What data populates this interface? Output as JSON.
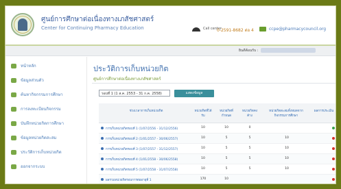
{
  "header": {
    "org_name_th": "ศูนย์การศึกษาต่อเนื่องทางเภสัชศาสตร์",
    "org_name_en": "Center for Continuing Pharmacy Education",
    "tel_label": "Call center",
    "tel_number": "0-2591-8682 ต่อ 4",
    "email": "ccpe@pharmacycouncil.org"
  },
  "userbar": {
    "label": "ยินดีต้อนรับ :"
  },
  "sidebar": {
    "items": [
      {
        "label": "หน้าหลัก"
      },
      {
        "label": "ข้อมูลส่วนตัว"
      },
      {
        "label": "ค้นหากิจกรรมการศึกษา"
      },
      {
        "label": "การลงทะเบียนกิจกรรม"
      },
      {
        "label": "บันทึกหน่วยกิตการศึกษา"
      },
      {
        "label": "ข้อมูลหน่วยกิตสะสม"
      },
      {
        "label": "ประวัติการเก็บหน่วยกิต"
      },
      {
        "label": "ออกจากระบบ"
      }
    ]
  },
  "main": {
    "title": "ประวัติการเก็บหน่วยกิต",
    "subtitle": "ศูนย์การศึกษาต่อเนื่องทางเภสัชศาสตร์",
    "select_value": "รอบที่ 1 (1 ส.ค. 2553 - 31 ก.ค. 2558)",
    "button_label": "แสดงข้อมูล"
  },
  "table": {
    "headers": [
      "ช่วงเวลาการเก็บหน่วยกิต",
      "หน่วยกิตที่ได้รับ",
      "หน่วยกิตที่กำหนด",
      "หน่วยกิตคงค้าง",
      "หน่วยกิตสะสมทั้งหมดจาก กิจกรรมการศึกษา",
      "ผลการประเมิน"
    ],
    "rows": [
      {
        "name": "การเก็บหน่วยกิตรอบที่ 1 (1/07/2556 - 31/12/2556)",
        "c1": "10",
        "c2": "10",
        "c3": "0",
        "c4": "",
        "status": "#3aa34a"
      },
      {
        "name": "การเก็บหน่วยกิตรอบที่ 2 (1/01/2557 - 30/06/2557)",
        "c1": "10",
        "c2": "5",
        "c3": "5",
        "c4": "10",
        "status": "#d8322b"
      },
      {
        "name": "การเก็บหน่วยกิตรอบที่ 3 (1/07/2557 - 31/12/2557)",
        "c1": "10",
        "c2": "5",
        "c3": "5",
        "c4": "10",
        "status": "#d8322b"
      },
      {
        "name": "การเก็บหน่วยกิตรอบที่ 4 (1/01/2558 - 30/06/2558)",
        "c1": "10",
        "c2": "5",
        "c3": "5",
        "c4": "10",
        "status": "#d8322b"
      },
      {
        "name": "การเก็บหน่วยกิตรอบที่ 5 (1/07/2558 - 31/07/2558)",
        "c1": "10",
        "c2": "5",
        "c3": "5",
        "c4": "10",
        "status": "#d8322b"
      },
      {
        "name": "ผลรวมหน่วยกิตรอบการต่ออายุที่ 1",
        "c1": "170",
        "c2": "10",
        "c3": "",
        "c4": "",
        "status": "#d8322b"
      }
    ]
  },
  "colors": {
    "background": "#6b7a16",
    "link": "#3f6fae",
    "accent_button": "#3a8f9b",
    "status_pass": "#3aa34a",
    "status_fail": "#d8322b"
  }
}
